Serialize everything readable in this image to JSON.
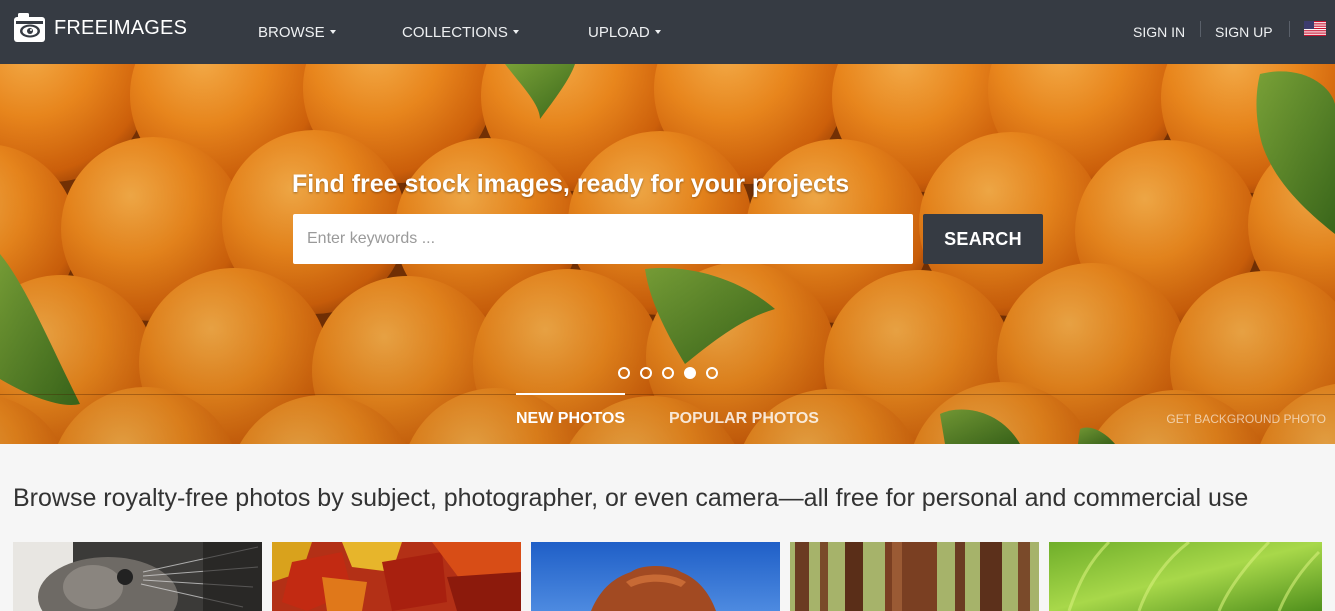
{
  "header": {
    "brand": "FREEIMAGES",
    "menu": [
      {
        "label": "BROWSE",
        "icon": "caret-down-icon"
      },
      {
        "label": "COLLECTIONS",
        "icon": "caret-down-icon"
      },
      {
        "label": "UPLOAD",
        "icon": "caret-down-icon"
      }
    ],
    "sign_in": "SIGN IN",
    "sign_up": "SIGN UP",
    "language_flag": "us-flag-icon"
  },
  "hero": {
    "title": "Find free stock images, ready for your projects",
    "search_placeholder": "Enter keywords ...",
    "search_value": "",
    "search_button": "SEARCH",
    "carousel": {
      "slide_count": 5,
      "active_index": 3
    },
    "tabs": [
      {
        "label": "NEW PHOTOS",
        "active": true
      },
      {
        "label": "POPULAR PHOTOS",
        "active": false
      }
    ],
    "get_background": "GET BACKGROUND PHOTO"
  },
  "main": {
    "browse_text": "Browse royalty-free photos by subject, photographer, or even camera—all free for personal and commercial use",
    "thumbnails": [
      {
        "subject": "cat",
        "icon": "cat-photo"
      },
      {
        "subject": "autumn leaves",
        "icon": "leaves-photo"
      },
      {
        "subject": "rock arch",
        "icon": "arch-photo"
      },
      {
        "subject": "forest",
        "icon": "forest-photo"
      },
      {
        "subject": "grass",
        "icon": "grass-photo"
      }
    ]
  },
  "colors": {
    "navbar": "#363b43",
    "accent_orange": "#f08a1c",
    "button_dark": "#363b43",
    "page_background": "#f6f6f6"
  }
}
